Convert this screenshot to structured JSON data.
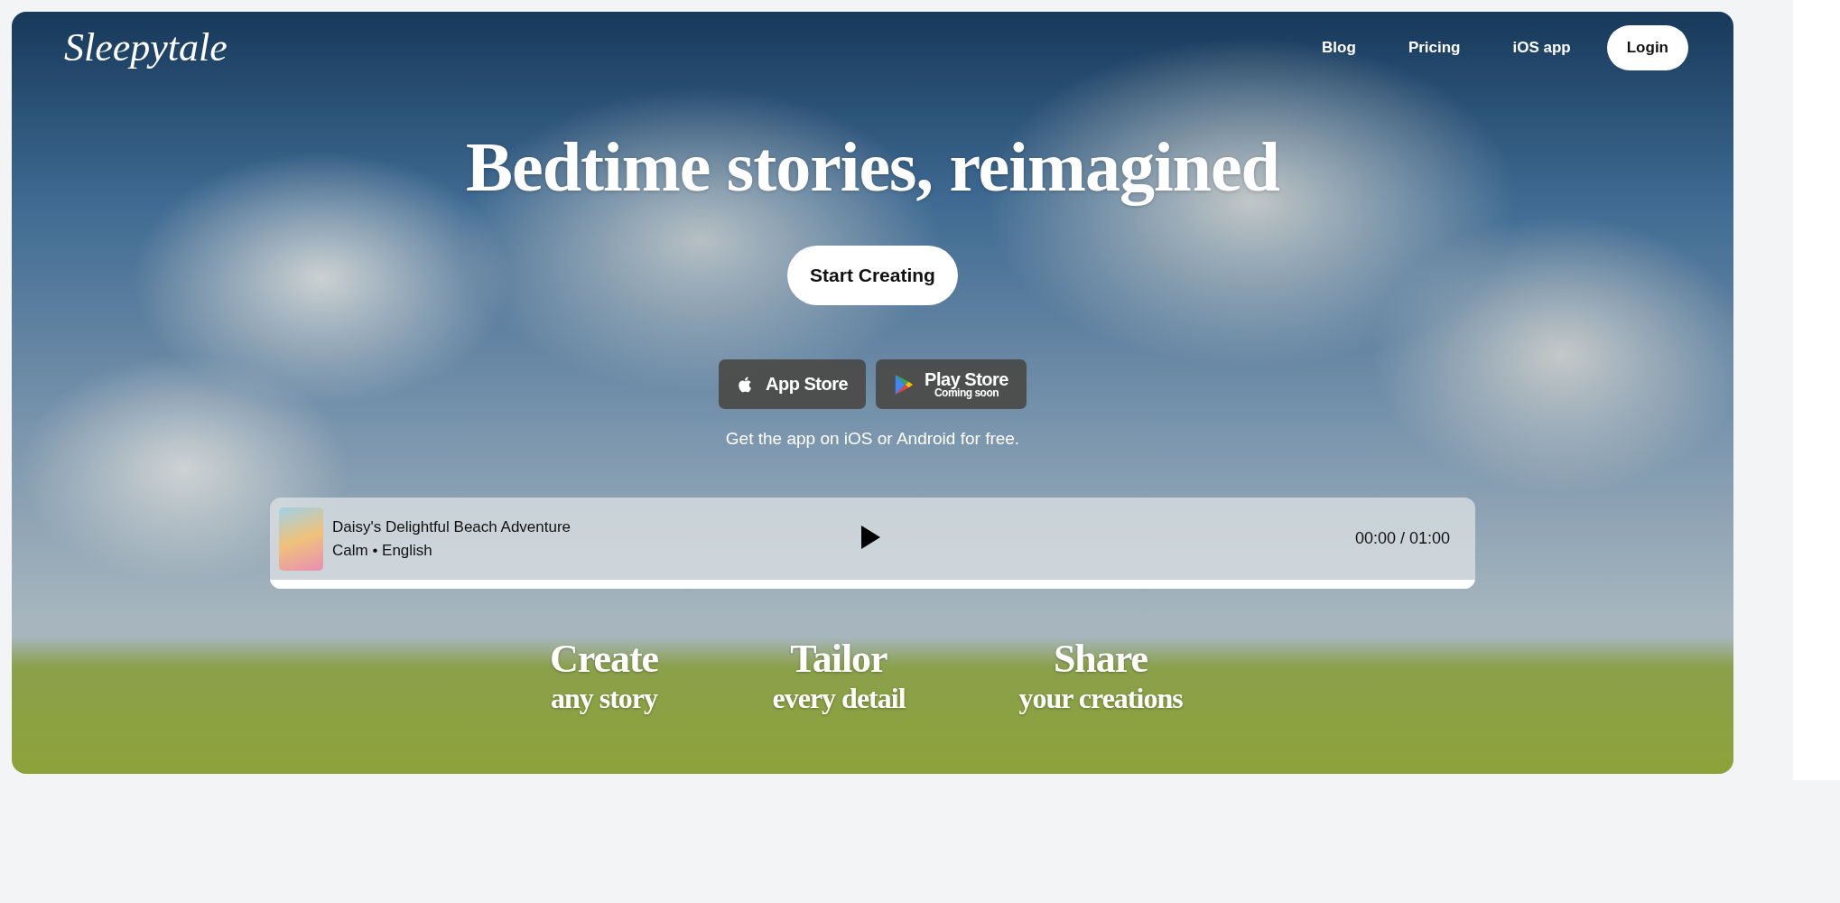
{
  "brand": {
    "logo": "Sleepytale"
  },
  "nav": [
    {
      "label": "Blog",
      "kind": "link"
    },
    {
      "label": "Pricing",
      "kind": "link"
    },
    {
      "label": "iOS app",
      "kind": "link"
    },
    {
      "label": "Login",
      "kind": "button"
    }
  ],
  "hero": {
    "title": "Bedtime stories, reimagined",
    "cta": "Start Creating"
  },
  "stores": [
    {
      "kind": "apple",
      "label": "App Store"
    },
    {
      "kind": "google",
      "label": "Play Store",
      "note": "Coming soon"
    }
  ],
  "stores_caption": "Get the app on iOS or Android for free.",
  "player": {
    "title": "Daisy's Delightful Beach Adventure",
    "meta": "Calm • English",
    "time": "00:00 / 01:00",
    "level": 0
  },
  "features": [
    {
      "title": "Create",
      "subtitle": "any story"
    },
    {
      "title": "Tailor",
      "subtitle": "every detail"
    },
    {
      "title": "Share",
      "subtitle": "your creations"
    }
  ]
}
